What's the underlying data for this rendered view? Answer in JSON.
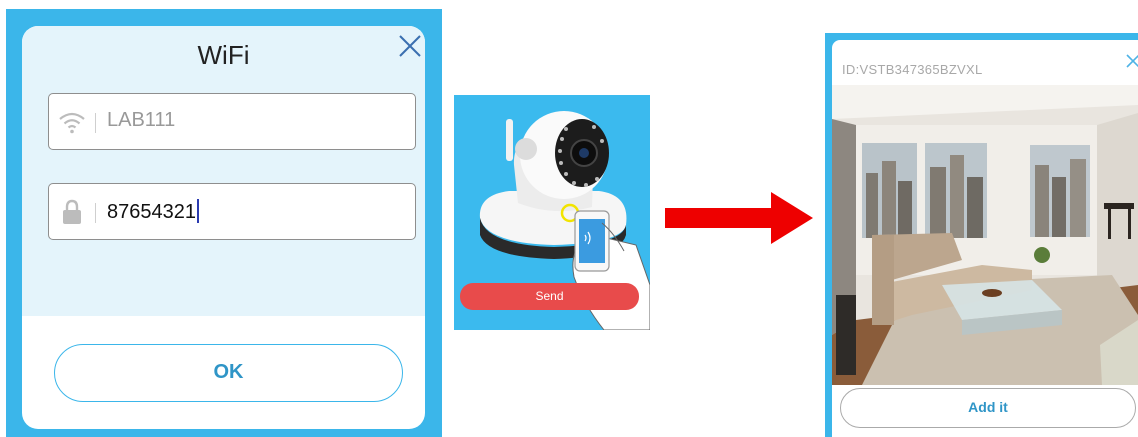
{
  "wifi_dialog": {
    "title": "WiFi",
    "ssid_value": "LAB111",
    "password_value": "87654321",
    "ok_label": "OK"
  },
  "camera_panel": {
    "send_label": "Send"
  },
  "preview_dialog": {
    "device_id": "ID:VSTB347365BZVXL",
    "add_label": "Add it"
  },
  "icons": {
    "close": "close-icon",
    "wifi": "wifi-icon",
    "lock": "lock-icon",
    "arrow": "arrow-right-icon"
  },
  "colors": {
    "accent_blue": "#3bb6ea",
    "dialog_tint": "#e4f4fb",
    "button_text": "#2f95c7",
    "send_red": "#e84b4b",
    "arrow_red": "#ee0000"
  }
}
